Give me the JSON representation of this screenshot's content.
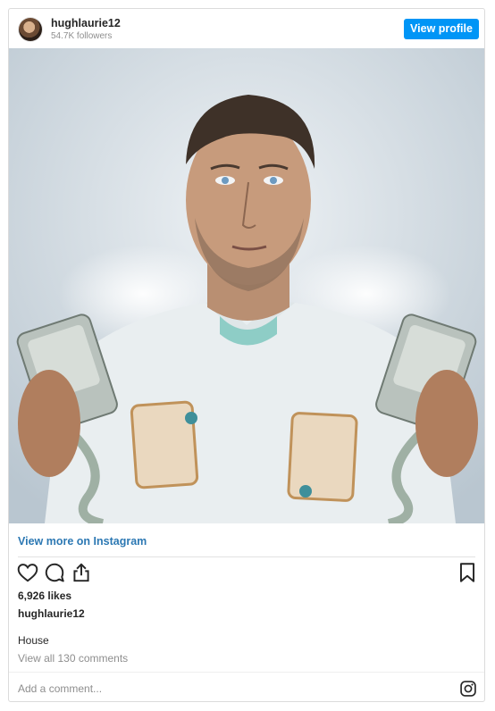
{
  "post": {
    "username": "hughlaurie12",
    "followers": "54.7K followers",
    "view_profile_label": "View profile",
    "view_more_label": "View more on Instagram",
    "likes": "6,926 likes",
    "caption_username": "hughlaurie12",
    "caption": "House",
    "view_comments": "View all 130 comments",
    "comment_placeholder": "Add a comment..."
  },
  "icons": {
    "like": "heart-icon",
    "comment": "comment-icon",
    "share": "share-icon",
    "save": "bookmark-icon",
    "brand": "instagram-icon"
  },
  "colors": {
    "accent": "#0095f6",
    "link": "#2c78b3",
    "muted": "#8e8e8e"
  }
}
